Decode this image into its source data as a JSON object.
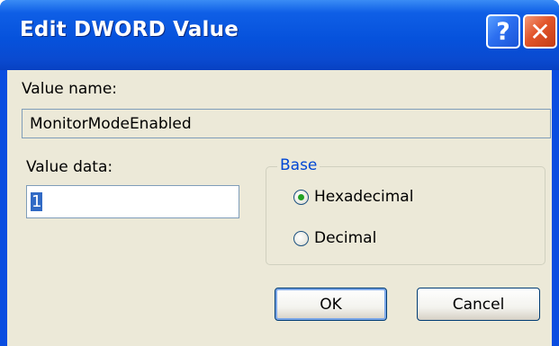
{
  "window": {
    "title": "Edit DWORD Value",
    "help_icon_glyph": "?",
    "close_icon_glyph": "✕"
  },
  "value_name": {
    "label": "Value name:",
    "value": "MonitorModeEnabled"
  },
  "value_data": {
    "label": "Value data:",
    "value": "1"
  },
  "base": {
    "legend": "Base",
    "options": [
      {
        "label": "Hexadecimal",
        "selected": true
      },
      {
        "label": "Decimal",
        "selected": false
      }
    ]
  },
  "buttons": {
    "ok_label": "OK",
    "cancel_label": "Cancel"
  },
  "colors": {
    "titlebar": "#0652dc",
    "dialog_bg": "#ece9d8",
    "group_legend": "#0046d5",
    "selection": "#316ac5"
  }
}
